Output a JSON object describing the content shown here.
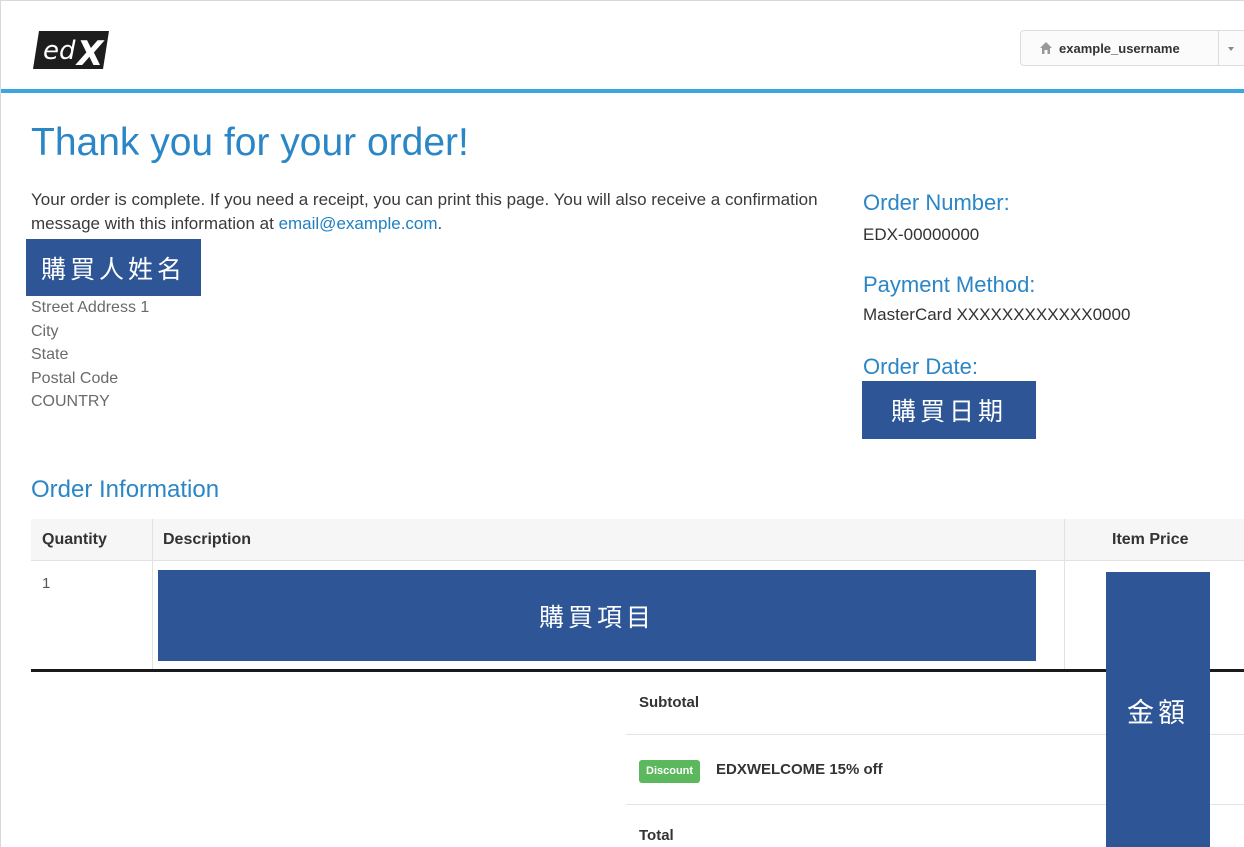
{
  "header": {
    "logo_text": "edX",
    "username": "example_username"
  },
  "page": {
    "title": "Thank you for your order!",
    "intro_text": "Your order is complete. If you need a receipt, you can print this page. You will also receive a confirmation message with this information at ",
    "email": "email@example.com",
    "intro_end": "."
  },
  "billing": {
    "buyer_name": "購買人姓名",
    "address_lines": [
      "Street Address 1",
      "City",
      "State",
      "Postal Code",
      "COUNTRY"
    ]
  },
  "order_meta": {
    "order_number_label": "Order Number:",
    "order_number": "EDX-00000000",
    "payment_method_label": "Payment Method:",
    "payment_method": "MasterCard XXXXXXXXXXXX0000",
    "order_date_label": "Order Date:",
    "order_date": "購買日期"
  },
  "order_info": {
    "section_title": "Order Information",
    "columns": {
      "quantity": "Quantity",
      "description": "Description",
      "item_price": "Item Price"
    },
    "rows": [
      {
        "quantity": "1",
        "description": "購買項目",
        "item_price": "金額"
      }
    ],
    "summary": {
      "subtotal_label": "Subtotal",
      "discount_badge": "Discount",
      "discount_text": "EDXWELCOME 15% off",
      "total_label": "Total"
    }
  },
  "colors": {
    "accent_blue": "#2a86c6",
    "header_rule": "#3ba7e0",
    "redaction": "#2e5696",
    "discount_green": "#5cb85c"
  }
}
